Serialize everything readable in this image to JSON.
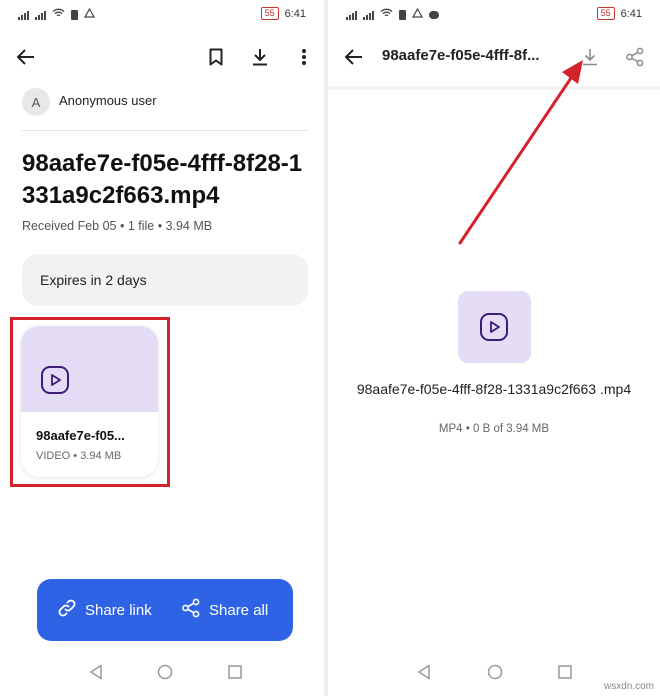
{
  "status_bar": {
    "network_left": "4G",
    "network_right": "4G",
    "battery": "55",
    "time": "6:41"
  },
  "file_detail": {
    "sender_initial": "A",
    "sender_name": "Anonymous user",
    "file_title": "98aafe7e-f05e-4fff-8f28-1331a9c2f663.mp4",
    "received_info": "Received Feb 05 • 1 file • 3.94 MB",
    "expires_text": "Expires in 2 days",
    "card_name": "98aafe7e-f05...",
    "card_meta": "VIDEO • 3.94 MB",
    "share_link_label": "Share link",
    "share_all_label": "Share all"
  },
  "file_view": {
    "title": "98aafe7e-f05e-4fff-8f...",
    "file_name": "98aafe7e-f05e-4fff-8f28-1331a9c2f663 .mp4",
    "file_meta": "MP4 • 0 B of 3.94 MB"
  },
  "watermark": "wsxdn.com",
  "colors": {
    "primary_blue": "#2f63e6",
    "thumb_lavender": "#e5dcf6",
    "highlight_red": "#d4232a",
    "icon_purple": "#3d1c7a"
  },
  "icons": [
    "back-arrow-icon",
    "bookmark-icon",
    "download-icon",
    "more-vertical-icon",
    "video-play-icon",
    "link-icon",
    "share-icon",
    "nav-back-icon",
    "nav-home-icon",
    "nav-recents-icon"
  ]
}
